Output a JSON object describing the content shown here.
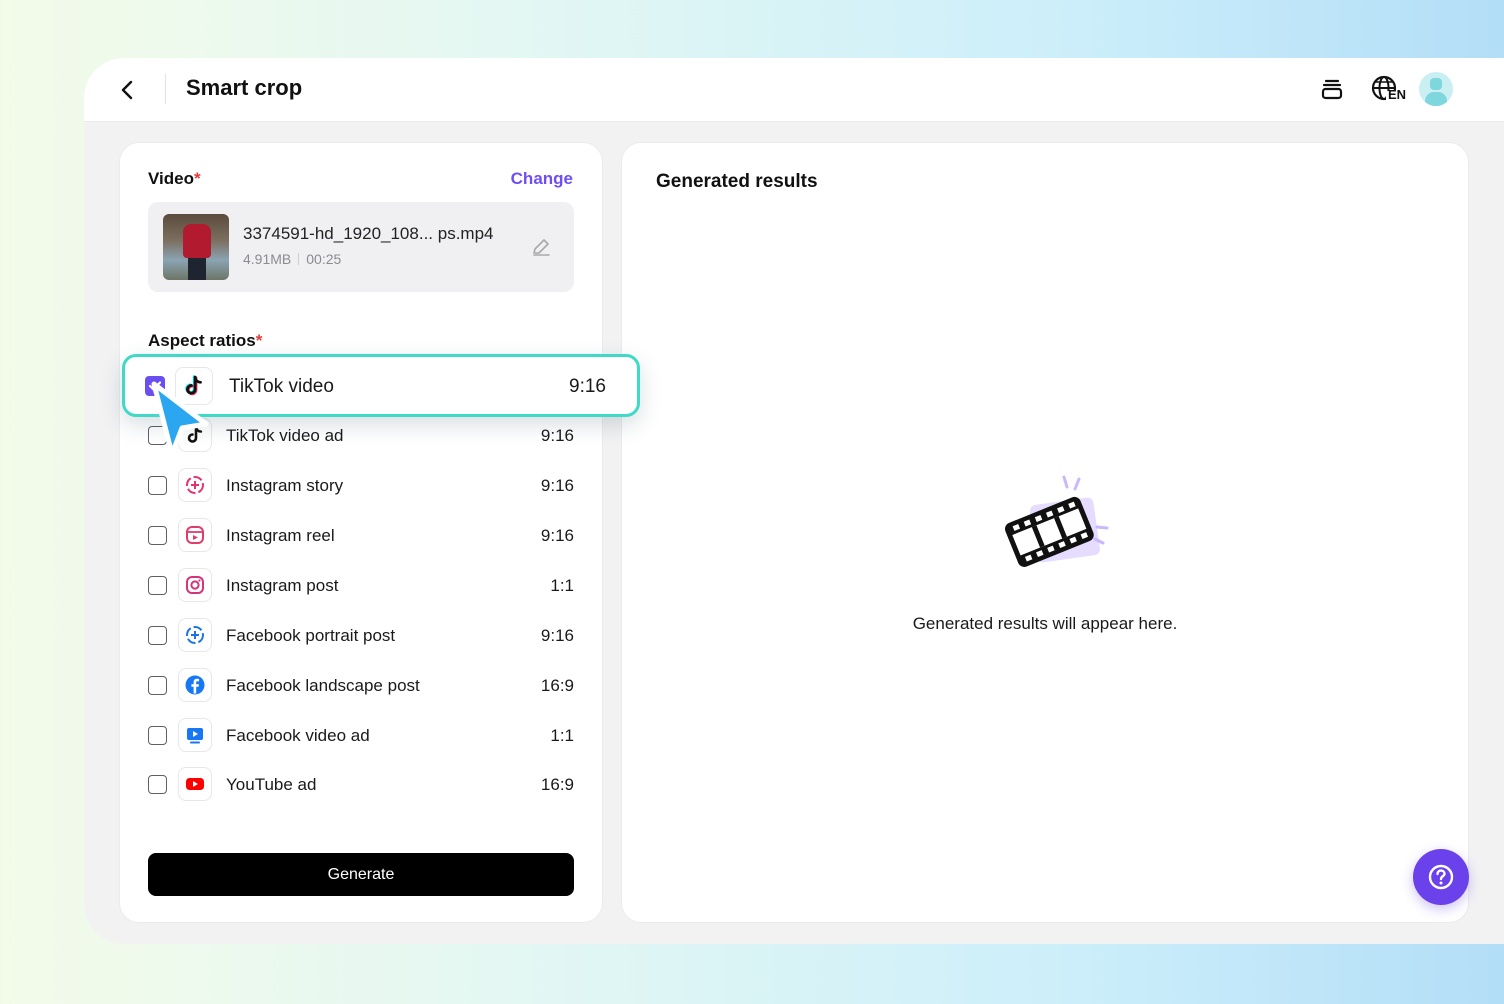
{
  "header": {
    "title": "Smart crop",
    "language": "EN"
  },
  "video": {
    "label": "Video",
    "required_mark": "*",
    "change_label": "Change",
    "file_name": "3374591-hd_1920_108...  ps.mp4",
    "file_size": "4.91MB",
    "duration": "00:25"
  },
  "aspect": {
    "label": "Aspect ratios",
    "required_mark": "*",
    "items": [
      {
        "label": "TikTok video",
        "ratio": "9:16",
        "checked": true,
        "icon": "tiktok-icon"
      },
      {
        "label": "TikTok video ad",
        "ratio": "9:16",
        "checked": false,
        "icon": "tiktok-icon"
      },
      {
        "label": "Instagram story",
        "ratio": "9:16",
        "checked": false,
        "icon": "instagram-story-icon"
      },
      {
        "label": "Instagram reel",
        "ratio": "9:16",
        "checked": false,
        "icon": "instagram-reel-icon"
      },
      {
        "label": "Instagram post",
        "ratio": "1:1",
        "checked": false,
        "icon": "instagram-icon"
      },
      {
        "label": "Facebook portrait post",
        "ratio": "9:16",
        "checked": false,
        "icon": "facebook-story-icon"
      },
      {
        "label": "Facebook landscape post",
        "ratio": "16:9",
        "checked": false,
        "icon": "facebook-icon"
      },
      {
        "label": "Facebook video ad",
        "ratio": "1:1",
        "checked": false,
        "icon": "facebook-video-icon"
      },
      {
        "label": "YouTube ad",
        "ratio": "16:9",
        "checked": false,
        "icon": "youtube-icon"
      }
    ]
  },
  "generate_label": "Generate",
  "results": {
    "title": "Generated results",
    "empty_text": "Generated results will appear here."
  },
  "colors": {
    "accent": "#6a4ff0",
    "highlight": "#3fd9c7",
    "cursor": "#2aa7f0"
  }
}
